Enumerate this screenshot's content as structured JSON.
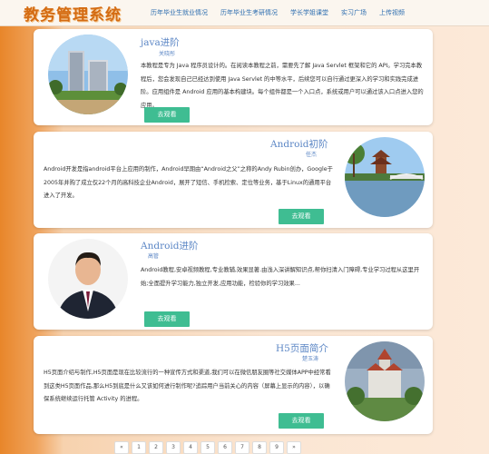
{
  "header": {
    "logo": "教务管理系统",
    "nav": [
      "历年毕业生就业情况",
      "历年毕业生考研情况",
      "学长学姐课堂",
      "实习广场",
      "上传视频"
    ]
  },
  "courses": [
    {
      "title": "java进阶",
      "author": "关晓彤",
      "desc": "本教程是专为 Java 程序员设计的。在阅读本教程之前，需要先了解 Java Servlet 框架和它的 API。学习完本教程后，您会发现自己已经达到使用 Java Servlet 的中等水平，后续您可以自行通过更深入的学习和实践完成进阶。应用组件是 Android 应用的基本构建块。每个组件都是一个入口点，系统或用户可以通过该入口点进入您的应用。",
      "button": "去观看"
    },
    {
      "title": "Android初阶",
      "author": "任杰",
      "desc": "Android开发是指android平台上应用的制作，Android早期由“Android之父”之称的Andy Rubin创办，Google于2005年并购了成立仅22个月的高科技企业Android，展开了短信、手机检索、定位等业务，基于Linux的通用平台进入了开发。",
      "button": "去观看"
    },
    {
      "title": "Android进阶",
      "author": "高管",
      "desc": "Android教程,安卓视频教程,专业教辅,效果显著.由浅入深讲解知识点,帮你扫清入门障碍,专业学习过程从这里开始;全面提升学习能力,独立开发,应用功能，检验你的学习效果...",
      "button": "去观看"
    },
    {
      "title": "H5页面简介",
      "author": "楚玉涛",
      "desc": "H5页面介绍与制作,H5页面是现在比较流行的一种宣传方式和渠道,我们可以在微信朋友圈等社交媒体APP中经常看到这类H5页面作品,那么H5到底是什么又该如何进行制作呢?追踪用户当前关心的内容（屏幕上显示的内容），以确保系统继续运行托管 Activity 的进程。",
      "button": "去观看"
    }
  ],
  "pager": {
    "prev": "«",
    "pages": [
      "1",
      "2",
      "3",
      "4",
      "5",
      "6",
      "7",
      "8",
      "9"
    ],
    "next": "»"
  }
}
